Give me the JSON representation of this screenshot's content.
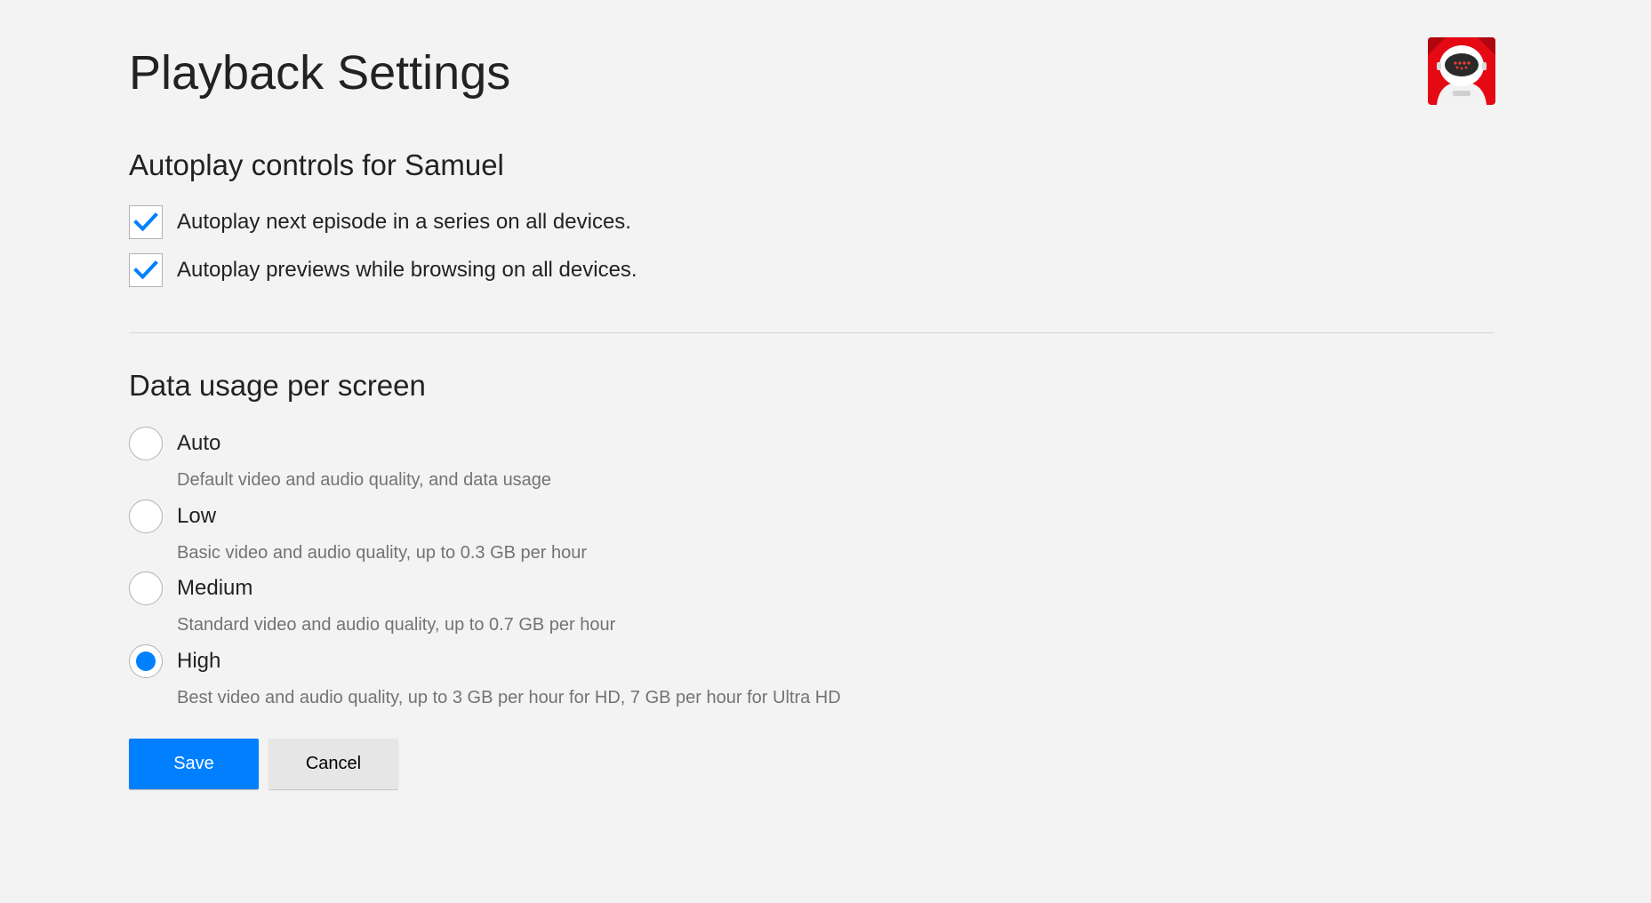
{
  "header": {
    "title": "Playback Settings",
    "avatar_icon": "robot-avatar-icon"
  },
  "autoplay": {
    "title": "Autoplay controls for Samuel",
    "options": [
      {
        "label": "Autoplay next episode in a series on all devices.",
        "checked": true
      },
      {
        "label": "Autoplay previews while browsing on all devices.",
        "checked": true
      }
    ]
  },
  "data_usage": {
    "title": "Data usage per screen",
    "selected": "High",
    "options": [
      {
        "label": "Auto",
        "description": "Default video and audio quality, and data usage"
      },
      {
        "label": "Low",
        "description": "Basic video and audio quality, up to 0.3 GB per hour"
      },
      {
        "label": "Medium",
        "description": "Standard video and audio quality, up to 0.7 GB per hour"
      },
      {
        "label": "High",
        "description": "Best video and audio quality, up to 3 GB per hour for HD, 7 GB per hour for Ultra HD"
      }
    ]
  },
  "actions": {
    "save_label": "Save",
    "cancel_label": "Cancel"
  },
  "colors": {
    "background": "#f3f3f3",
    "accent": "#0080ff",
    "secondary_button": "#e6e6e6",
    "avatar_red": "#e50914"
  }
}
